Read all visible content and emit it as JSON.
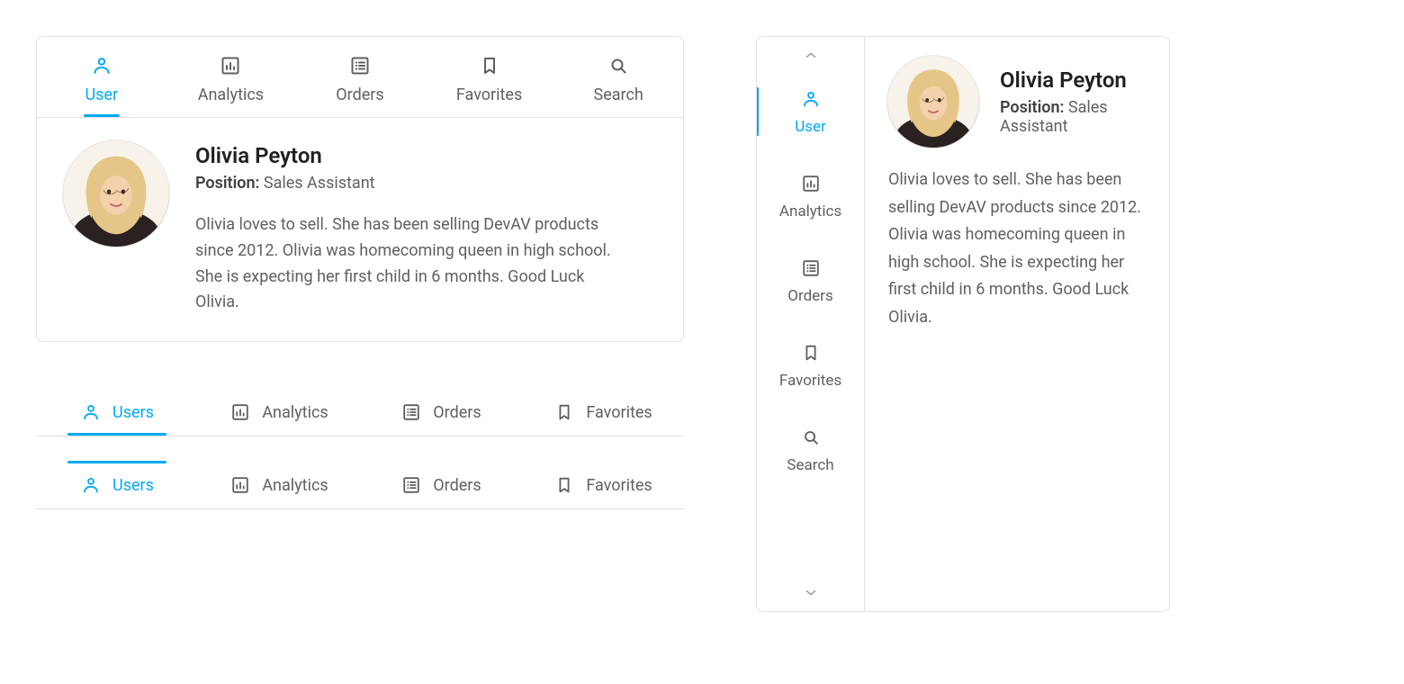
{
  "colors": {
    "accent": "#03a9f4",
    "text": "#606060",
    "border": "#e0e0e0"
  },
  "panelTop": {
    "tabs": [
      {
        "label": "User",
        "icon": "user",
        "active": true
      },
      {
        "label": "Analytics",
        "icon": "analytics",
        "active": false
      },
      {
        "label": "Orders",
        "icon": "orders",
        "active": false
      },
      {
        "label": "Favorites",
        "icon": "bookmark",
        "active": false
      },
      {
        "label": "Search",
        "icon": "search",
        "active": false
      }
    ],
    "profile": {
      "name": "Olivia Peyton",
      "position_label": "Position:",
      "position_value": "Sales Assistant",
      "notes": "Olivia loves to sell. She has been selling DevAV products since 2012. Olivia was homecoming queen in high school. She is expecting her first child in 6 months. Good Luck Olivia."
    }
  },
  "tabbar2": {
    "tabs": [
      {
        "label": "Users",
        "icon": "user",
        "active": true
      },
      {
        "label": "Analytics",
        "icon": "analytics",
        "active": false
      },
      {
        "label": "Orders",
        "icon": "orders",
        "active": false
      },
      {
        "label": "Favorites",
        "icon": "bookmark",
        "active": false
      }
    ]
  },
  "tabbar3": {
    "tabs": [
      {
        "label": "Users",
        "icon": "user",
        "active": true
      },
      {
        "label": "Analytics",
        "icon": "analytics",
        "active": false
      },
      {
        "label": "Orders",
        "icon": "orders",
        "active": false
      },
      {
        "label": "Favorites",
        "icon": "bookmark",
        "active": false
      }
    ]
  },
  "panelSide": {
    "tabs": [
      {
        "label": "User",
        "icon": "user",
        "active": true
      },
      {
        "label": "Analytics",
        "icon": "analytics",
        "active": false
      },
      {
        "label": "Orders",
        "icon": "orders",
        "active": false
      },
      {
        "label": "Favorites",
        "icon": "bookmark",
        "active": false
      },
      {
        "label": "Search",
        "icon": "search",
        "active": false
      }
    ],
    "profile": {
      "name": "Olivia Peyton",
      "position_label": "Position:",
      "position_value": "Sales Assistant",
      "notes": "Olivia loves to sell. She has been selling DevAV products since 2012. Olivia was homecoming queen in high school. She is expecting her first child in 6 months. Good Luck Olivia."
    }
  }
}
